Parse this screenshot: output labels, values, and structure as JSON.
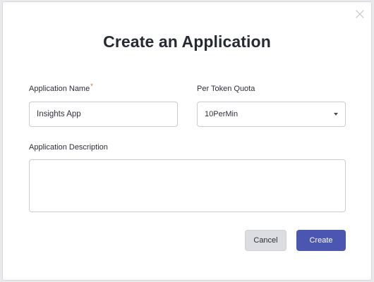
{
  "dialog": {
    "title": "Create an Application",
    "close_icon": "close-icon"
  },
  "form": {
    "app_name": {
      "label": "Application Name",
      "required_marker": "*",
      "value": "Insights App"
    },
    "token_quota": {
      "label": "Per Token Quota",
      "selected": "10PerMin",
      "caret_icon": "chevron-down-icon"
    },
    "description": {
      "label": "Application Description",
      "value": ""
    }
  },
  "actions": {
    "cancel_label": "Cancel",
    "create_label": "Create"
  },
  "colors": {
    "primary": "#4a56b0",
    "required": "#e8552c",
    "cancel_bg": "#dcdde1"
  }
}
